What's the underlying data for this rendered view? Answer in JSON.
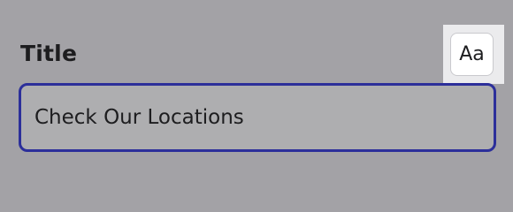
{
  "field": {
    "label": "Title",
    "value": "Check Our Locations"
  },
  "font_button": {
    "label": "Aa",
    "icon": "text-format-icon"
  },
  "colors": {
    "background": "#a3a2a6",
    "input_border_focus": "#2c2f9a",
    "input_fill": "#aeaeb0",
    "text": "#1d1d1f"
  }
}
